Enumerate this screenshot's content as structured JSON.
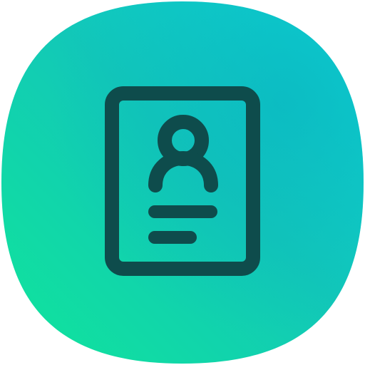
{
  "icon": {
    "name": "contact-card-icon",
    "colors": {
      "gradient_start": "#10E59A",
      "gradient_mid": "#12C8B8",
      "gradient_end": "#0BD3D8",
      "glyph": "#0E4C4C"
    }
  }
}
